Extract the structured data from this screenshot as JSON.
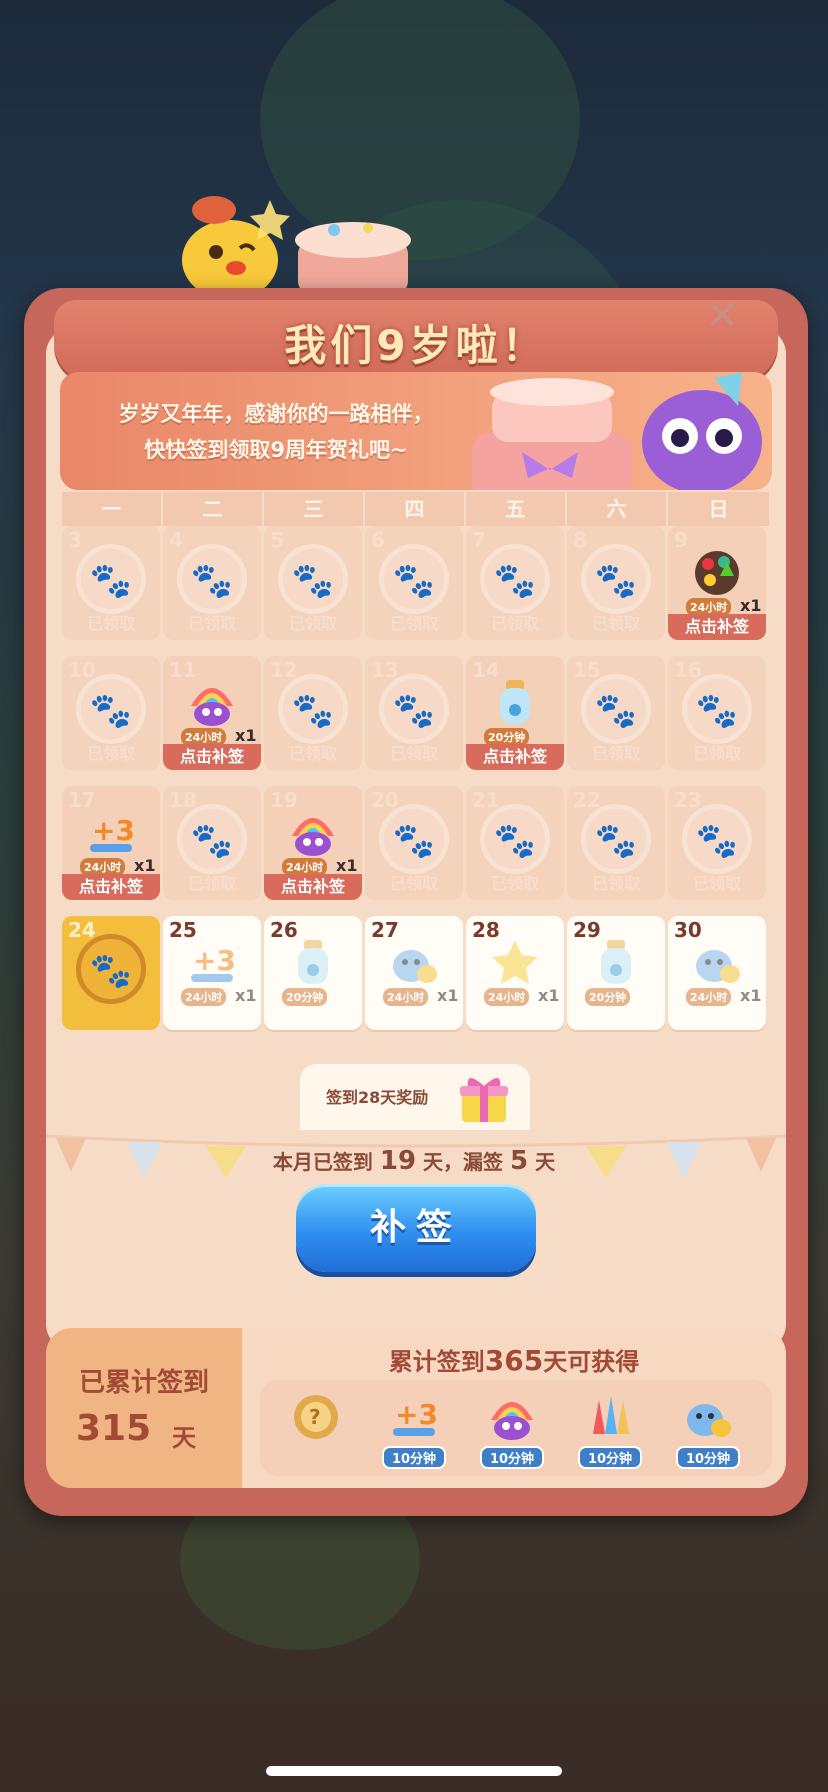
{
  "title": "我们9岁啦！",
  "close_icon": "close-icon",
  "intro": {
    "line1": "岁岁又年年，感谢你的一路相伴，",
    "line2": "快快签到领取9周年贺礼吧~"
  },
  "weekdays": [
    "一",
    "二",
    "三",
    "四",
    "五",
    "六",
    "日"
  ],
  "labels": {
    "claimed": "已领取",
    "makeup": "点击补签"
  },
  "days": [
    {
      "day": "3",
      "state": "claimed"
    },
    {
      "day": "4",
      "state": "claimed"
    },
    {
      "day": "5",
      "state": "claimed"
    },
    {
      "day": "6",
      "state": "claimed"
    },
    {
      "day": "7",
      "state": "claimed"
    },
    {
      "day": "8",
      "state": "claimed"
    },
    {
      "day": "9",
      "state": "makeup",
      "reward_icon": "color-bomb-icon",
      "tag": "24小时",
      "count": "x1"
    },
    {
      "day": "10",
      "state": "claimed"
    },
    {
      "day": "11",
      "state": "makeup",
      "reward_icon": "rainbow-bird-icon",
      "tag": "24小时",
      "count": "x1"
    },
    {
      "day": "12",
      "state": "claimed"
    },
    {
      "day": "13",
      "state": "claimed"
    },
    {
      "day": "14",
      "state": "makeup",
      "reward_icon": "bottle-icon",
      "tag": "20分钟",
      "count": ""
    },
    {
      "day": "15",
      "state": "claimed"
    },
    {
      "day": "16",
      "state": "claimed"
    },
    {
      "day": "17",
      "state": "makeup",
      "reward_icon": "plus-three-icon",
      "tag": "24小时",
      "count": "x1"
    },
    {
      "day": "18",
      "state": "claimed"
    },
    {
      "day": "19",
      "state": "makeup",
      "reward_icon": "rainbow-bird-icon",
      "tag": "24小时",
      "count": "x1"
    },
    {
      "day": "20",
      "state": "claimed"
    },
    {
      "day": "21",
      "state": "claimed"
    },
    {
      "day": "22",
      "state": "claimed"
    },
    {
      "day": "23",
      "state": "claimed"
    },
    {
      "day": "24",
      "state": "today"
    },
    {
      "day": "25",
      "state": "future",
      "reward_icon": "plus-three-icon",
      "tag": "24小时",
      "count": "x1"
    },
    {
      "day": "26",
      "state": "future",
      "reward_icon": "bottle-icon",
      "tag": "20分钟",
      "count": ""
    },
    {
      "day": "27",
      "state": "future",
      "reward_icon": "blue-chick-icon",
      "tag": "24小时",
      "count": "x1"
    },
    {
      "day": "28",
      "state": "future",
      "reward_icon": "star-icon",
      "tag": "24小时",
      "count": "x1"
    },
    {
      "day": "29",
      "state": "future",
      "reward_icon": "bottle-icon",
      "tag": "20分钟",
      "count": ""
    },
    {
      "day": "30",
      "state": "future",
      "reward_icon": "blue-chick-icon",
      "tag": "24小时",
      "count": "x1"
    }
  ],
  "milestone": {
    "text": "签到28天奖励",
    "icon": "gift-box-icon"
  },
  "month_stats": {
    "prefix": "本月已签到",
    "signed": "19",
    "mid": "天，漏签",
    "missed": "5",
    "suffix": "天"
  },
  "makeup_button": "补签",
  "cumulative": {
    "label": "已累计签到",
    "value": "315",
    "unit": "天",
    "title_prefix": "累计签到",
    "title_days": "365",
    "title_suffix": "天可获得",
    "rewards": [
      {
        "icon": "mystery-medal-icon",
        "tag": ""
      },
      {
        "icon": "plus-three-icon",
        "tag": "10分钟"
      },
      {
        "icon": "rainbow-bird-icon",
        "tag": "10分钟"
      },
      {
        "icon": "rockets-icon",
        "tag": "10分钟"
      },
      {
        "icon": "blue-chick-icon",
        "tag": "10分钟"
      }
    ]
  },
  "colors": {
    "panel": "#c7665a",
    "panel_inner": "#f6dcc6",
    "makeup_red": "#d96b5d",
    "today_yellow": "#f3bd3d",
    "button_blue": "#2f8ff0"
  }
}
